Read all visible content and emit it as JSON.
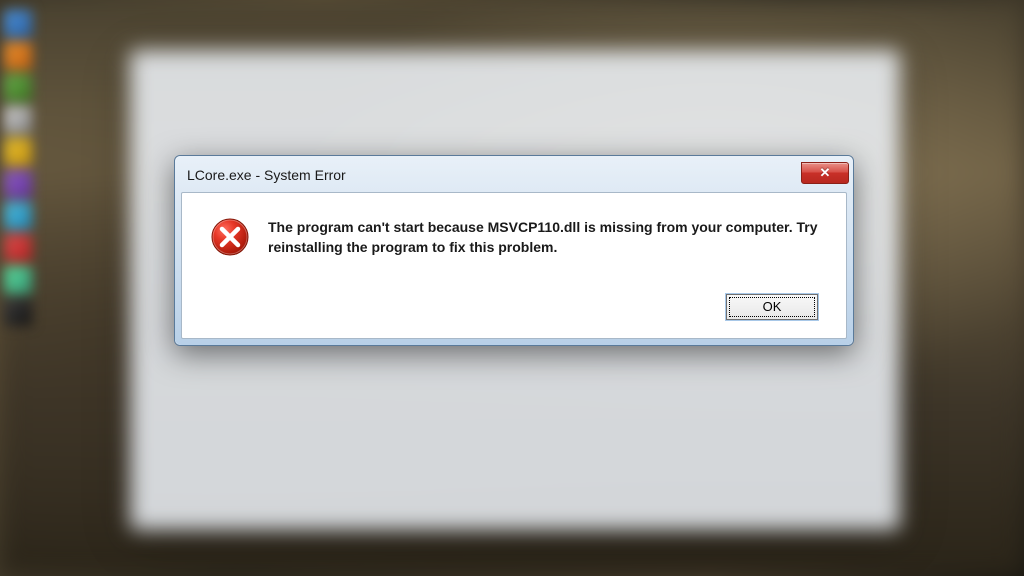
{
  "dialog": {
    "title": "LCore.exe - System Error",
    "message": "The program can't start because MSVCP110.dll is missing from your computer. Try reinstalling the program to fix this problem.",
    "ok_label": "OK",
    "close_label": "✕"
  }
}
